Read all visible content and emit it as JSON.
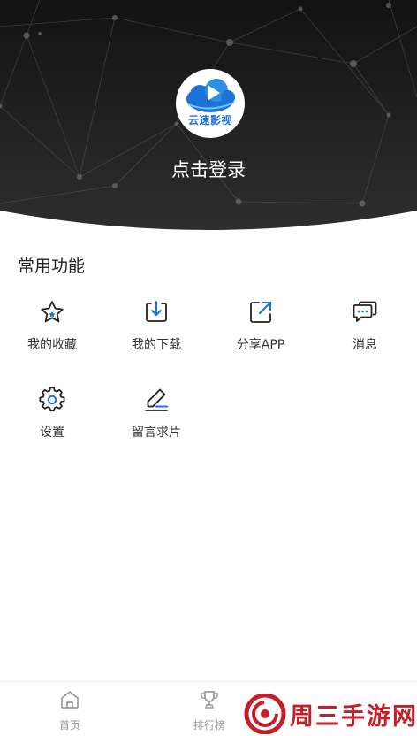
{
  "header": {
    "logo_text": "云速影视",
    "login_label": "点击登录"
  },
  "common_functions": {
    "title": "常用功能",
    "items": [
      {
        "label": "我的收藏",
        "icon": "star-icon"
      },
      {
        "label": "我的下载",
        "icon": "download-icon"
      },
      {
        "label": "分享APP",
        "icon": "share-icon"
      },
      {
        "label": "消息",
        "icon": "message-icon"
      },
      {
        "label": "设置",
        "icon": "gear-icon"
      },
      {
        "label": "留言求片",
        "icon": "edit-icon"
      }
    ]
  },
  "tabbar": {
    "items": [
      {
        "label": "首页",
        "icon": "home-icon"
      },
      {
        "label": "排行榜",
        "icon": "trophy-icon"
      }
    ]
  },
  "watermark": {
    "text": "周三手游网"
  },
  "colors": {
    "accent": "#1b73d9",
    "hero_dark": "#1c1c1c",
    "watermark": "#c4202a"
  }
}
